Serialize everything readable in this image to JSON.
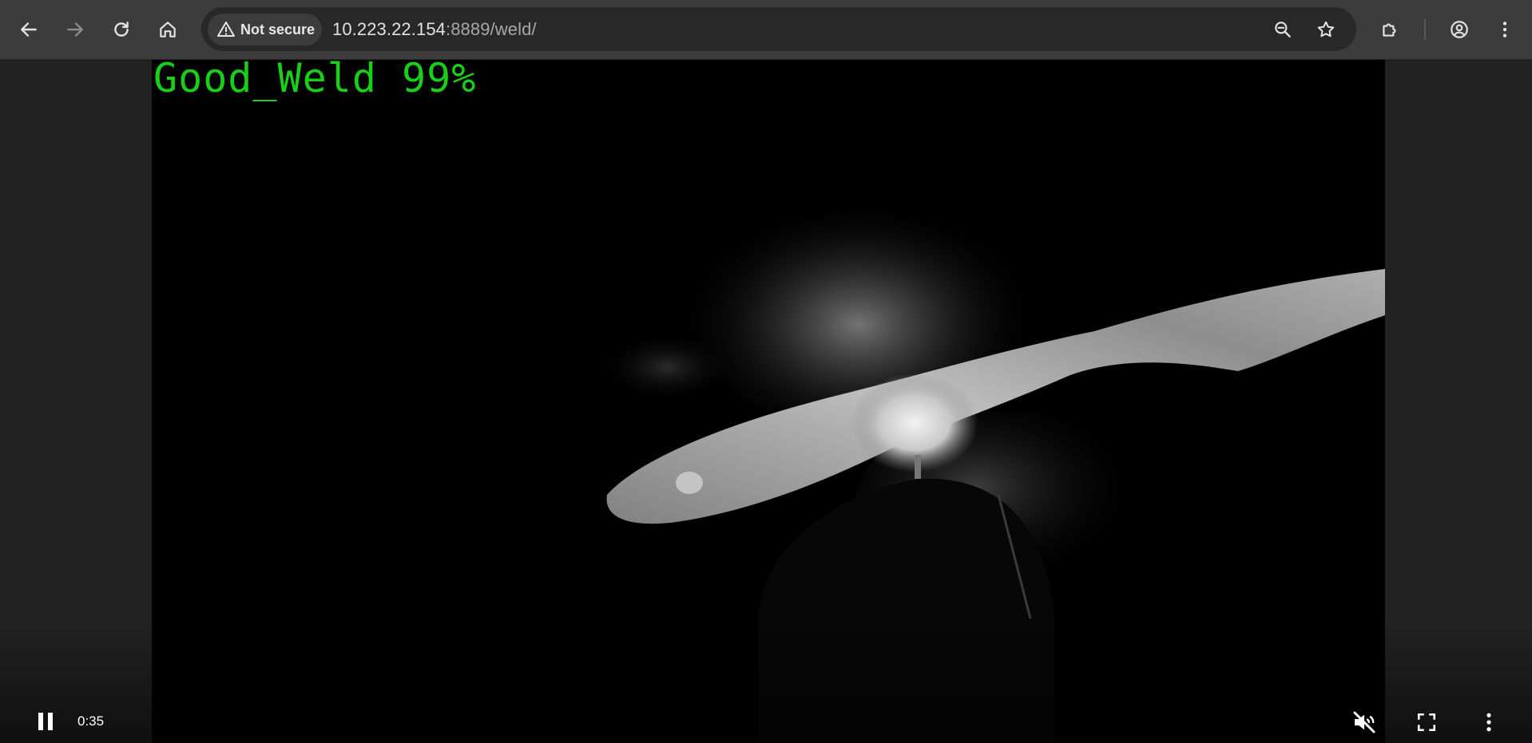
{
  "browser": {
    "security_label": "Not secure",
    "url_host": "10.223.22.154",
    "url_rest": ":8889/weld/"
  },
  "video": {
    "overlay_text": "Good_Weld 99%",
    "current_time": "0:35",
    "muted": true,
    "playing": true
  },
  "icons": {
    "back": "arrow-left-icon",
    "forward": "arrow-right-icon",
    "reload": "reload-icon",
    "home": "home-icon",
    "warning": "warning-icon",
    "zoom": "zoom-out-icon",
    "bookmark": "star-icon",
    "extensions": "puzzle-icon",
    "profile": "profile-icon",
    "menu": "kebab-menu-icon",
    "pause": "pause-icon",
    "mute": "volume-muted-icon",
    "fullscreen": "fullscreen-icon"
  },
  "colors": {
    "overlay_text": "#17d017",
    "toolbar": "#3c3c3c",
    "omnibox": "#282828"
  }
}
